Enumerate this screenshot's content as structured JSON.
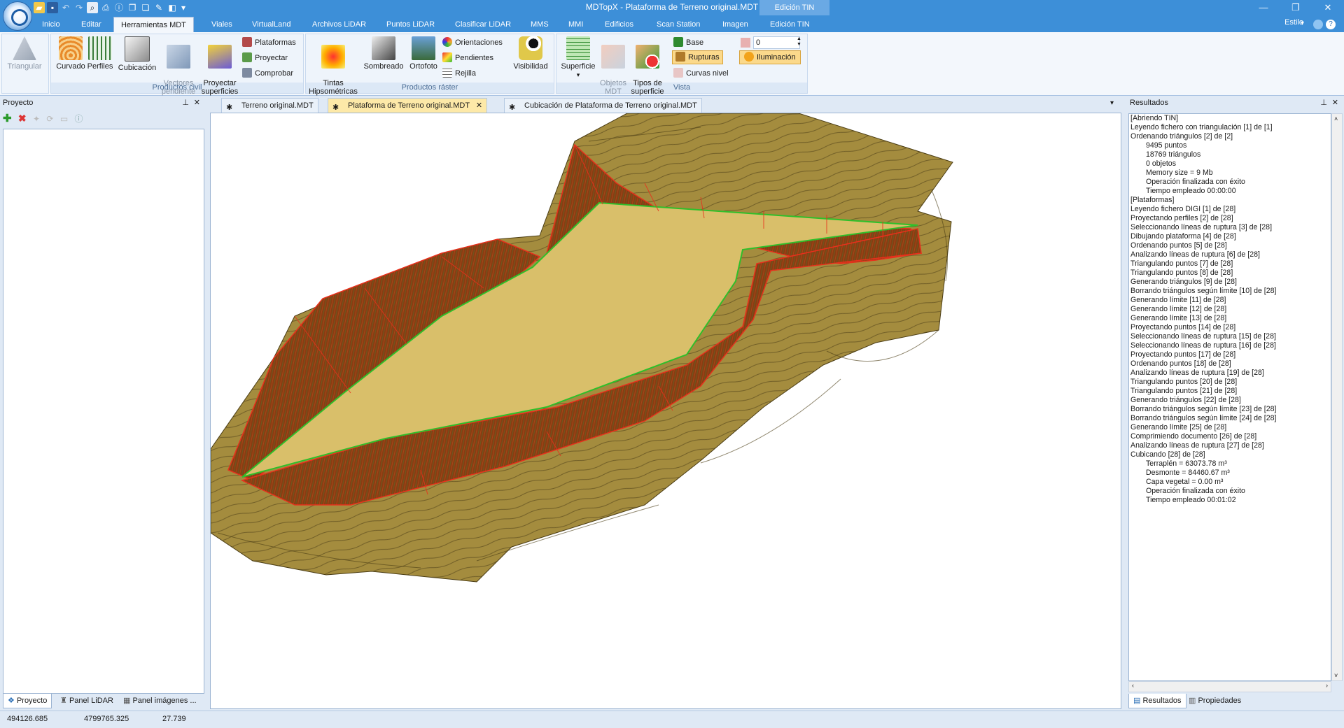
{
  "window": {
    "title": "MDTopX - Plataforma de Terreno original.MDT",
    "context_tab_header": "Edición TIN",
    "minimize": "—",
    "maximize": "❐",
    "close": "✕"
  },
  "ribbon_tabs": [
    "Inicio",
    "Editar",
    "Herramientas MDT",
    "Viales",
    "VirtualLand",
    "Archivos LiDAR",
    "Puntos LiDAR",
    "Clasificar LiDAR",
    "MMS",
    "MMI",
    "Edificios",
    "Scan Station",
    "Imagen",
    "Edición TIN"
  ],
  "active_tab": "Herramientas MDT",
  "style_menu": "Estilo",
  "groups": {
    "civil": {
      "label": "Productos civil",
      "triangular": "Triangular",
      "curvado": "Curvado",
      "perfiles": "Perfiles",
      "cubicacion": "Cubicación",
      "vectores": "Vectores\npendiente",
      "proyectar_sup": "Proyectar\nsuperficies",
      "plataformas": "Plataformas",
      "proyectar": "Proyectar",
      "comprobar": "Comprobar"
    },
    "raster": {
      "label": "Productos ráster",
      "tintas": "Tintas\nHipsométricas",
      "sombreado": "Sombreado",
      "ortofoto": "Ortofoto",
      "orientaciones": "Orientaciones",
      "pendientes": "Pendientes",
      "rejilla": "Rejilla",
      "visibilidad": "Visibilidad"
    },
    "vista": {
      "label": "Vista",
      "superficie": "Superficie",
      "objetos": "Objetos\nMDT",
      "tipos": "Tipos de\nsuperficie",
      "base": "Base",
      "rupturas": "Rupturas",
      "curvas": "Curvas nivel",
      "spin_value": "0",
      "iluminacion": "Iluminación"
    }
  },
  "left_panel": {
    "title": "Proyecto",
    "tabs": [
      "Proyecto",
      "Panel LiDAR",
      "Panel imágenes ..."
    ]
  },
  "doc_tabs": [
    "Terreno original.MDT",
    "Plataforma de Terreno original.MDT",
    "Cubicación de Plataforma de Terreno original.MDT"
  ],
  "right_panel": {
    "title": "Resultados",
    "tabs": [
      "Resultados",
      "Propiedades"
    ],
    "log": [
      {
        "t": "[Abriendo TIN]",
        "i": false
      },
      {
        "t": "Leyendo fichero con triangulación [1] de [1]",
        "i": false
      },
      {
        "t": "Ordenando triángulos [2] de [2]",
        "i": false
      },
      {
        "t": "9495 puntos",
        "i": true
      },
      {
        "t": "18769 triángulos",
        "i": true
      },
      {
        "t": "0 objetos",
        "i": true
      },
      {
        "t": "Memory size = 9 Mb",
        "i": true
      },
      {
        "t": "Operación finalizada con éxito",
        "i": true
      },
      {
        "t": "Tiempo empleado 00:00:00",
        "i": true
      },
      {
        "t": "[Plataformas]",
        "i": false
      },
      {
        "t": "Leyendo fichero DIGI [1] de [28]",
        "i": false
      },
      {
        "t": "Proyectando perfiles [2] de [28]",
        "i": false
      },
      {
        "t": "Seleccionando líneas de ruptura [3] de [28]",
        "i": false
      },
      {
        "t": "Dibujando plataforma [4] de [28]",
        "i": false
      },
      {
        "t": "Ordenando puntos [5] de [28]",
        "i": false
      },
      {
        "t": "Analizando líneas de ruptura [6] de [28]",
        "i": false
      },
      {
        "t": "Triangulando puntos [7] de [28]",
        "i": false
      },
      {
        "t": "Triangulando puntos [8] de [28]",
        "i": false
      },
      {
        "t": "Generando triángulos [9] de [28]",
        "i": false
      },
      {
        "t": "Borrando triángulos según límite [10] de [28]",
        "i": false
      },
      {
        "t": "Generando límite [11] de [28]",
        "i": false
      },
      {
        "t": "Generando límite [12] de [28]",
        "i": false
      },
      {
        "t": "Generando límite [13] de [28]",
        "i": false
      },
      {
        "t": "Proyectando puntos [14] de [28]",
        "i": false
      },
      {
        "t": "Seleccionando líneas de ruptura [15] de [28]",
        "i": false
      },
      {
        "t": "Seleccionando líneas de ruptura [16] de [28]",
        "i": false
      },
      {
        "t": "Proyectando puntos [17] de [28]",
        "i": false
      },
      {
        "t": "Ordenando puntos [18] de [28]",
        "i": false
      },
      {
        "t": "Analizando líneas de ruptura [19] de [28]",
        "i": false
      },
      {
        "t": "Triangulando puntos [20] de [28]",
        "i": false
      },
      {
        "t": "Triangulando puntos [21] de [28]",
        "i": false
      },
      {
        "t": "Generando triángulos [22] de [28]",
        "i": false
      },
      {
        "t": "Borrando triángulos según límite [23] de [28]",
        "i": false
      },
      {
        "t": "Borrando triángulos según límite [24] de [28]",
        "i": false
      },
      {
        "t": "Generando límite [25] de [28]",
        "i": false
      },
      {
        "t": "Comprimiendo documento [26] de [28]",
        "i": false
      },
      {
        "t": "Analizando líneas de ruptura [27] de [28]",
        "i": false
      },
      {
        "t": "Cubicando [28] de [28]",
        "i": false
      },
      {
        "t": "Terraplén = 63073.78 m³",
        "i": true
      },
      {
        "t": "Desmonte = 84460.67 m³",
        "i": true
      },
      {
        "t": "Capa vegetal = 0.00 m³",
        "i": true
      },
      {
        "t": "Operación finalizada con éxito",
        "i": true
      },
      {
        "t": "Tiempo empleado 00:01:02",
        "i": true
      }
    ]
  },
  "status": {
    "x": "494126.685",
    "y": "4799765.325",
    "z": "27.739"
  },
  "colors": {
    "titlebar": "#3d8fd8",
    "terrain": "#a48c3e",
    "platform": "#d9bf6a",
    "slope": "#8a3b12",
    "breakline": "#e8301c",
    "edge": "#2fbf2a"
  }
}
